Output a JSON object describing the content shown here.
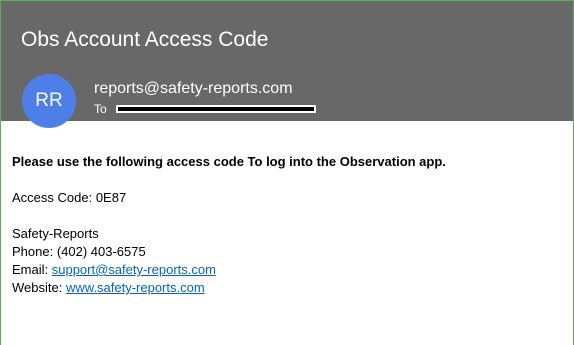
{
  "email": {
    "subject": "Obs Account Access Code",
    "avatar_initials": "RR",
    "sender": "reports@safety-reports.com",
    "to_label": "To"
  },
  "body": {
    "instruction": "Please use the following access code To log into the Observation app.",
    "access_code_line": "Access Code: 0E87",
    "company": "Safety-Reports",
    "phone_line": "Phone: (402) 403-6575",
    "email_label": "Email: ",
    "email_link": "support@safety-reports.com",
    "website_label": "Website: ",
    "website_link": "www.safety-reports.com"
  },
  "colors": {
    "header_bg": "#686868",
    "avatar_bg": "#4e7fe8",
    "link": "#0563c1",
    "frame_border": "#5bb048"
  }
}
